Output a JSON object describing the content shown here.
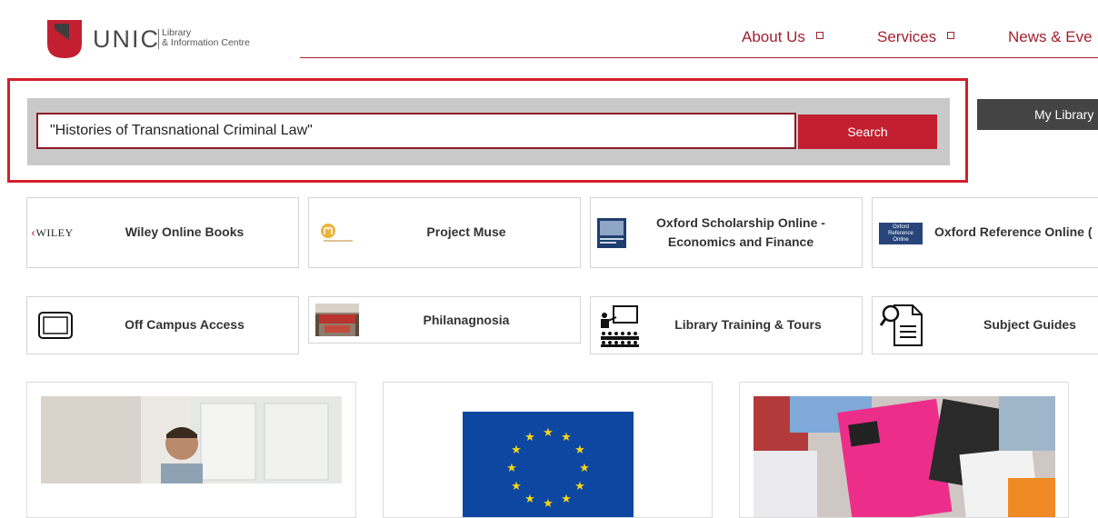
{
  "header": {
    "logo_word": "UNIC",
    "logo_sub_1": "Library",
    "logo_sub_2": "& Information Centre",
    "nav": [
      {
        "label": "About Us"
      },
      {
        "label": "Services"
      },
      {
        "label": "News & Eve"
      }
    ]
  },
  "search": {
    "query": "\"Histories of Transnational Criminal Law\"",
    "button_label": "Search"
  },
  "my_library": {
    "label": "My Library"
  },
  "resources_row1": [
    {
      "label": "Wiley Online Books",
      "icon": "wiley-logo-icon",
      "icon_text": "WILEY"
    },
    {
      "label": "Project Muse",
      "icon": "project-muse-logo-icon"
    },
    {
      "label": "Oxford Scholarship Online -",
      "label2": "Economics and Finance",
      "icon": "oxford-book-icon"
    },
    {
      "label": "Oxford Reference Online (",
      "icon": "oxford-reference-logo-icon",
      "icon_text_1": "Oxford",
      "icon_text_2": "Reference",
      "icon_text_3": "Online"
    }
  ],
  "resources_row2": [
    {
      "label": "Off Campus Access",
      "icon": "tablet-icon"
    },
    {
      "label": "Philanagnosia",
      "icon": "library-room-photo-icon"
    },
    {
      "label": "Library Training & Tours",
      "icon": "presentation-classroom-icon"
    },
    {
      "label": "Subject Guides",
      "icon": "document-search-icon"
    }
  ],
  "colors": {
    "brand": "#a3202e",
    "search_button": "#c31f30",
    "highlight": "#d2202a",
    "eu_blue": "#0e47a1",
    "eu_star": "#f6d514"
  }
}
